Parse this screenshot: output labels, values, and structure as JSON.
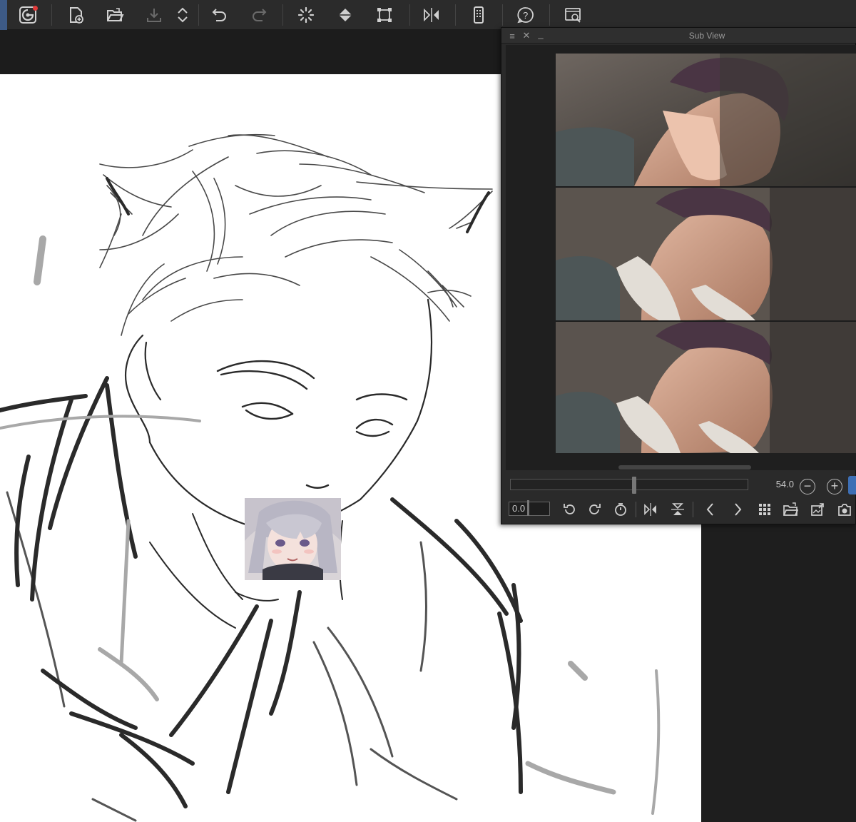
{
  "toolbar": {
    "icons": [
      "app-logo-icon",
      "new-canvas-icon",
      "open-folder-icon",
      "save-icon",
      "layer-order-icon",
      "undo-icon",
      "redo-icon",
      "loading-icon",
      "fill-icon",
      "transform-icon",
      "flip-horizontal-icon",
      "device-icon",
      "help-icon",
      "settings-icon"
    ],
    "notification_color": "#e03a3a"
  },
  "subview": {
    "title": "Sub View",
    "menu_icon": "≡",
    "close_icon": "✕",
    "minimize_icon": "_",
    "zoom_value": "54.0",
    "zoom_out_label": "−",
    "zoom_in_label": "+",
    "angle_value": "0.0",
    "accent_color": "#3d6fb5"
  },
  "canvas": {
    "background": "#ffffff",
    "sticker": "anime-girl-sticker"
  }
}
